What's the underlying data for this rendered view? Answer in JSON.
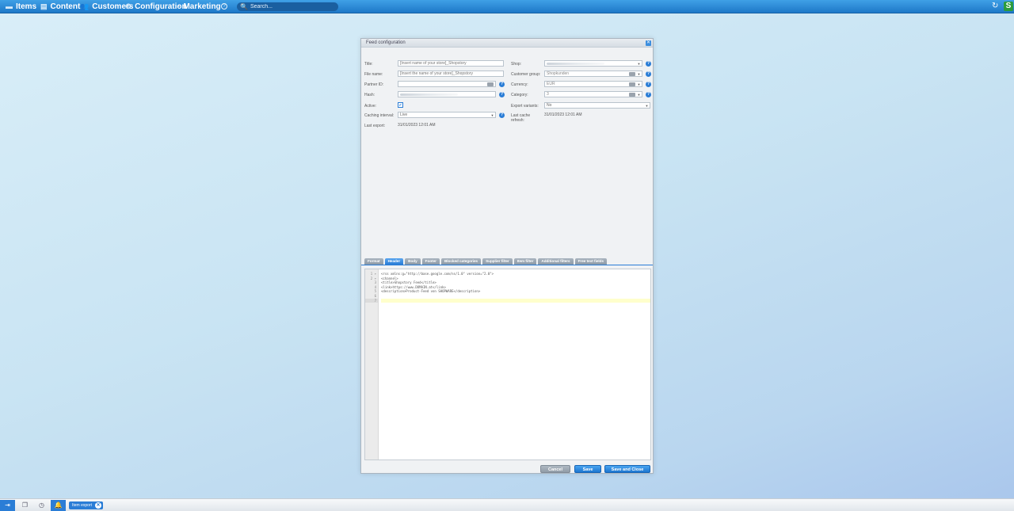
{
  "topbar": {
    "menu": [
      {
        "label": "Items",
        "icon": "items-icon"
      },
      {
        "label": "Content",
        "icon": "content-icon"
      },
      {
        "label": "Customers",
        "icon": "customers-icon"
      },
      {
        "label": "Configuration",
        "icon": "configuration-icon"
      },
      {
        "label": "Marketing",
        "icon": "marketing-icon"
      }
    ],
    "search_placeholder": "Search...",
    "brand": "S"
  },
  "window": {
    "title": "Feed configuration",
    "fields": {
      "title_label": "Title:",
      "title_placeholder": "[Insert name of your store]_Shopstory",
      "filename_label": "File name:",
      "filename_placeholder": "[Insert the name of your store]_Shopstory",
      "partner_label": "Partner ID:",
      "partner_value": "",
      "hash_label": "Hash:",
      "hash_value": "",
      "active_label": "Active:",
      "active_checked": true,
      "caching_label": "Caching interval:",
      "caching_value": "Live",
      "last_export_label": "Last export:",
      "last_export_value": "31/01/2023 12:01 AM",
      "shop_label": "Shop:",
      "shop_value": "",
      "customer_group_label": "Customer group:",
      "customer_group_value": "Shopkunden",
      "currency_label": "Currency:",
      "currency_value": "EUR",
      "category_label": "Category:",
      "category_value": "3",
      "export_variants_label": "Export variants:",
      "export_variants_value": "No",
      "last_cache_label_1": "Last cache",
      "last_cache_label_2": "refresh:",
      "last_cache_value": "31/01/2023 12:01 AM"
    },
    "tabs": [
      {
        "label": "Format",
        "active": false
      },
      {
        "label": "Header",
        "active": true
      },
      {
        "label": "Body",
        "active": false
      },
      {
        "label": "Footer",
        "active": false
      },
      {
        "label": "Blocked categories",
        "active": false
      },
      {
        "label": "Supplier filter",
        "active": false
      },
      {
        "label": "Item filter",
        "active": false
      },
      {
        "label": "Additional filters",
        "active": false
      },
      {
        "label": "Free text fields",
        "active": false
      }
    ],
    "editor": {
      "line_numbers": [
        "1 ▾",
        "2 ▾",
        "3",
        "4",
        "5",
        "6",
        "7"
      ],
      "lines": [
        "<rss xmlns:g=\"http://base.google.com/ns/1.0\" version=\"2.0\">",
        "<channel>",
        "<title>Shopstory Feed</title>",
        "<link>https://www.DOMAIN.at</link>",
        "<description>Product-Feed von SHOPWARE</description>",
        "",
        ""
      ]
    },
    "buttons": {
      "cancel": "Cancel",
      "save": "Save",
      "save_close": "Save and Close"
    }
  },
  "footer": {
    "task_label": "Item export"
  }
}
